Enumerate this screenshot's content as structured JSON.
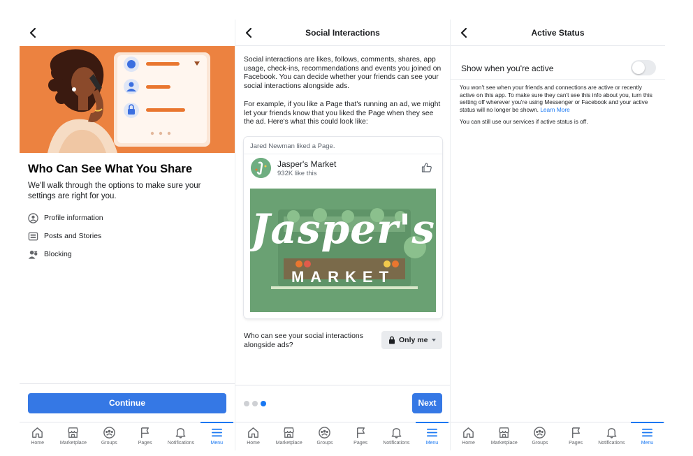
{
  "panel1": {
    "title": "Who Can See What You Share",
    "intro": "We'll walk through the options to make sure your settings are right for you.",
    "options": [
      {
        "label": "Profile information",
        "icon": "profile-icon"
      },
      {
        "label": "Posts and Stories",
        "icon": "posts-icon"
      },
      {
        "label": "Blocking",
        "icon": "blocking-icon"
      }
    ],
    "continue_label": "Continue"
  },
  "panel2": {
    "header": "Social Interactions",
    "para1": "Social interactions are likes, follows, comments, shares, app usage, check-ins, recommendations and events you joined on Facebook. You can decide whether your friends can see your social interactions alongside ads.",
    "para2": "For example, if you like a Page that's running an ad, we might let your friends know that you liked the Page when they see the ad. Here's what this could look like:",
    "card": {
      "liked_by": "Jared Newman liked a Page.",
      "page_name": "Jasper's Market",
      "likes": "932K like this",
      "ad_title": "Jasper's",
      "ad_subtitle": "MARKET"
    },
    "question": "Who can see your social interactions alongside ads?",
    "audience": "Only me",
    "next_label": "Next",
    "step_total": 3,
    "step_current": 3
  },
  "panel3": {
    "header": "Active Status",
    "toggle_label": "Show when you're active",
    "toggle_on": false,
    "desc": "You won't see when your friends and connections are active or recently active on this app. To make sure they can't see this info about you, turn this setting off wherever you're using Messenger or Facebook and your active status will no longer be shown.",
    "learn_more": "Learn More",
    "note": "You can still use our services if active status is off."
  },
  "nav": [
    {
      "label": "Home",
      "icon": "home-icon"
    },
    {
      "label": "Marketplace",
      "icon": "marketplace-icon"
    },
    {
      "label": "Groups",
      "icon": "groups-icon"
    },
    {
      "label": "Pages",
      "icon": "flag-icon"
    },
    {
      "label": "Notifications",
      "icon": "bell-icon"
    },
    {
      "label": "Menu",
      "icon": "menu-icon",
      "active": true
    }
  ],
  "colors": {
    "accent": "#1877f2",
    "button": "#3578e5",
    "hero": "#ec8240",
    "ad_bg": "#6aa173"
  }
}
